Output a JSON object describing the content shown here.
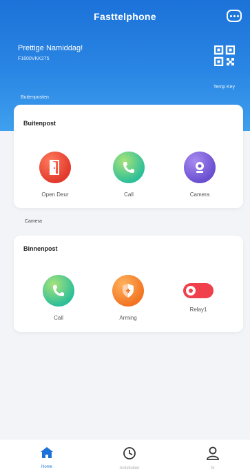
{
  "header": {
    "title": "Fasttelphone",
    "greeting": "Prettige Namiddag!",
    "device_id": "F1600VKK275",
    "temp_key_label": "Temp Key",
    "section_label": "Buitenposten",
    "accent": "#1c72d8",
    "chat_icon": "chat-bubble-icon",
    "qr_icon": "qr-code-icon"
  },
  "outdoor": {
    "title": "Buitenpost",
    "actions": [
      {
        "label": "Open Deur",
        "icon": "door-icon",
        "color": "#e23a2c"
      },
      {
        "label": "Call",
        "icon": "phone-icon",
        "color": "#2fbf98"
      },
      {
        "label": "Camera",
        "icon": "camera-icon",
        "color": "#6a4fd0"
      }
    ]
  },
  "camera_label": "Camera",
  "indoor": {
    "title": "Binnenpost",
    "actions": [
      {
        "label": "Call",
        "icon": "phone-icon",
        "color": "#2fbf98"
      },
      {
        "label": "Arming",
        "icon": "shield-icon",
        "color": "#f27524"
      },
      {
        "label": "Relay1",
        "icon": "toggle-icon",
        "color": "#f0404c",
        "state": "off"
      }
    ]
  },
  "tabbar": {
    "tabs": [
      {
        "label": "Home",
        "icon": "home-icon",
        "active": true
      },
      {
        "label": "Activiteiten",
        "icon": "clock-icon",
        "active": false
      },
      {
        "label": "Ik",
        "icon": "user-icon",
        "active": false
      }
    ]
  }
}
